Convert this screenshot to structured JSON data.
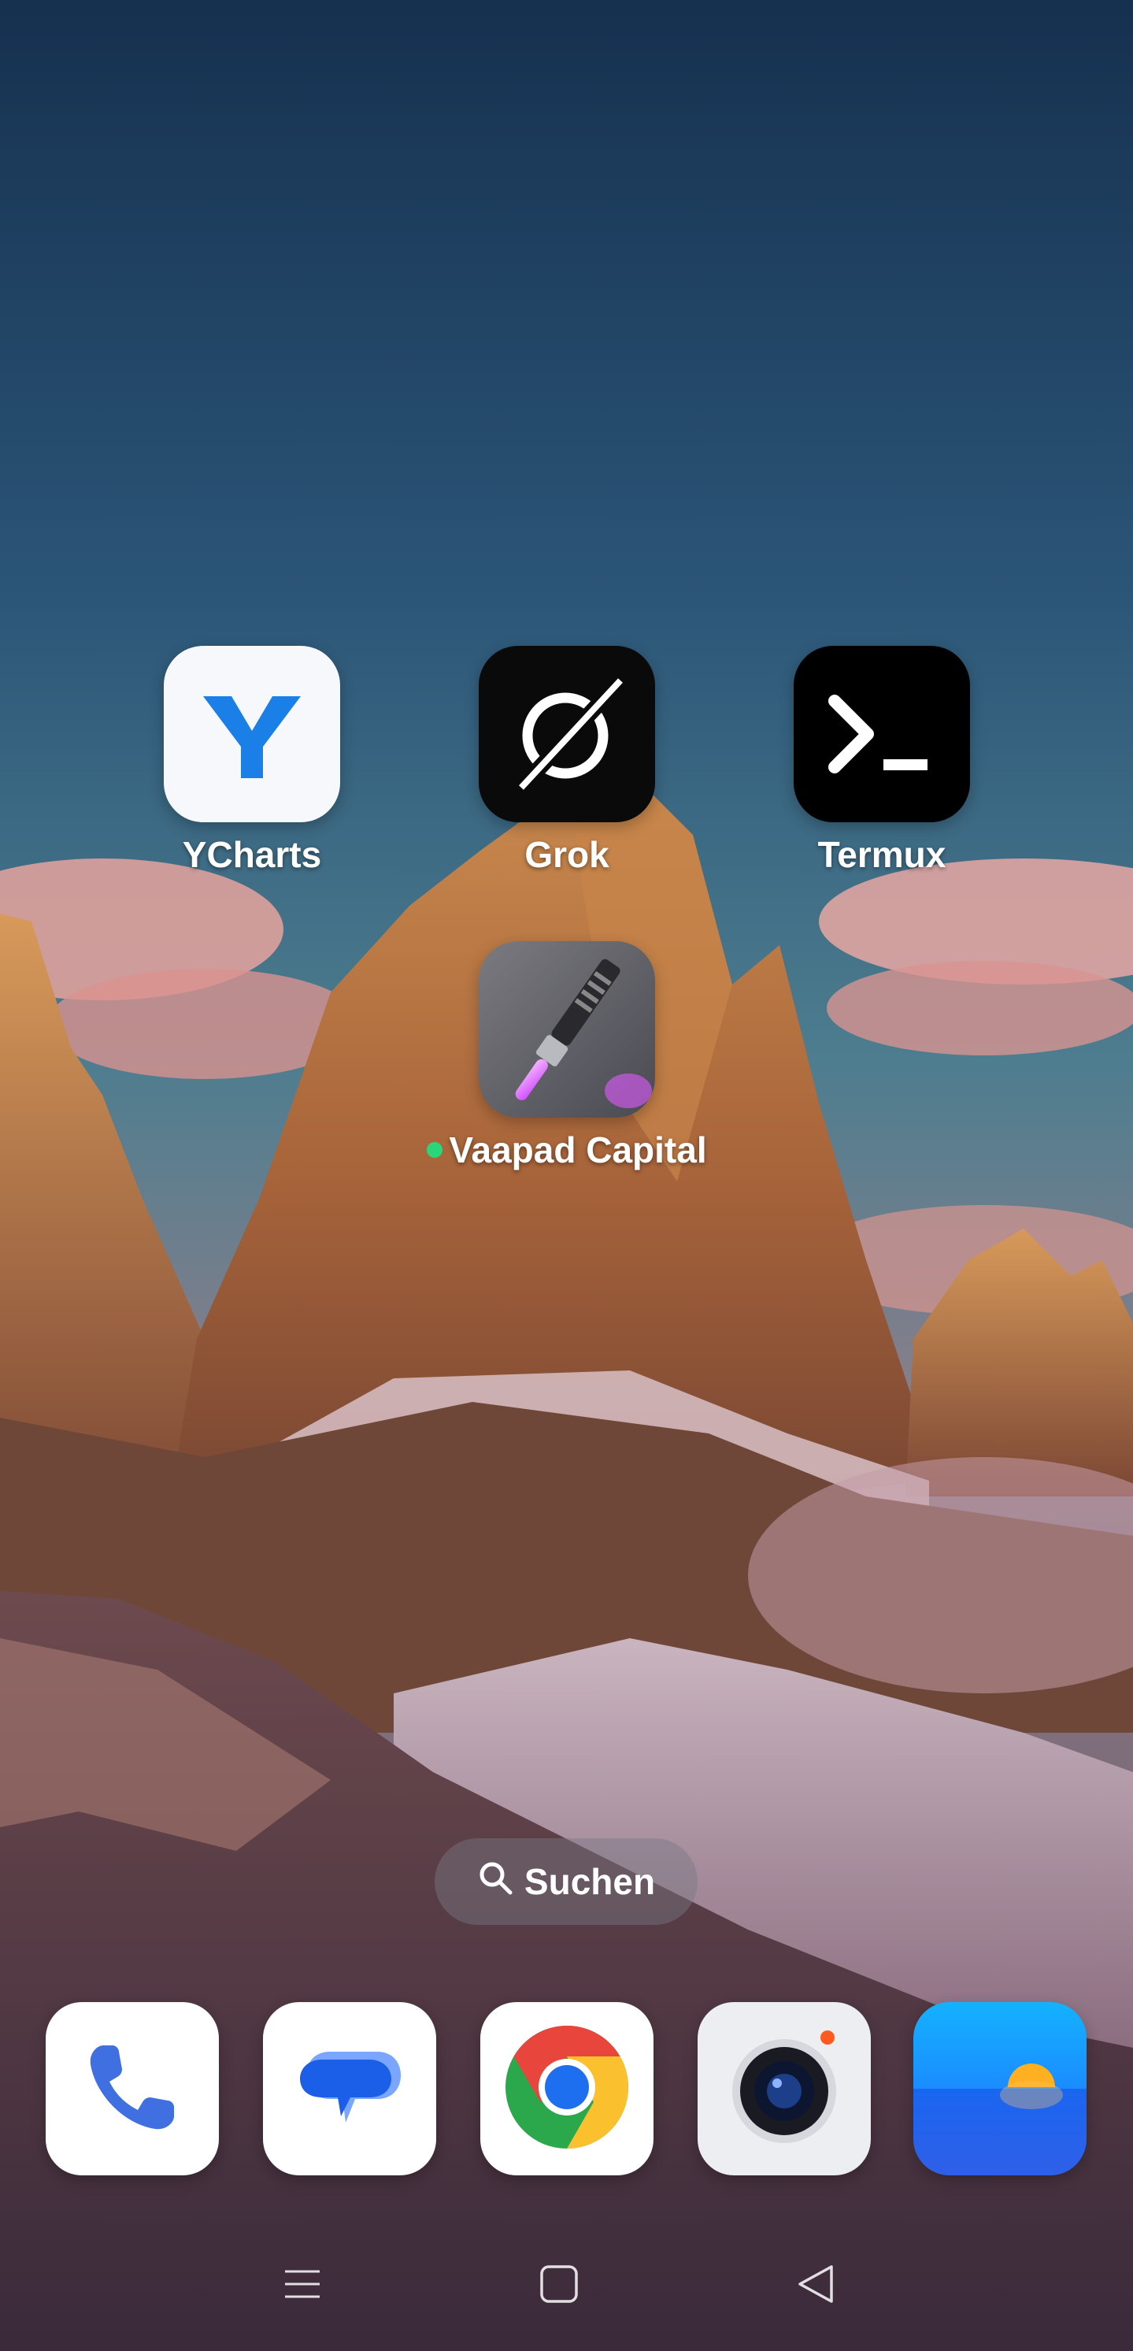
{
  "home_apps": [
    {
      "label": "YCharts",
      "icon": "ycharts-icon"
    },
    {
      "label": "Grok",
      "icon": "grok-icon"
    },
    {
      "label": "Termux",
      "icon": "terminal-icon"
    },
    {
      "label": "Vaapad Capital",
      "icon": "lightsaber-icon",
      "new_dot": true
    }
  ],
  "search": {
    "label": "Suchen",
    "icon": "search-icon"
  },
  "dock": [
    {
      "icon": "phone-icon"
    },
    {
      "icon": "messages-icon"
    },
    {
      "icon": "chrome-icon"
    },
    {
      "icon": "camera-icon"
    },
    {
      "icon": "gallery-icon"
    }
  ],
  "navbar": [
    {
      "icon": "menu-icon"
    },
    {
      "icon": "home-square-icon"
    },
    {
      "icon": "back-triangle-icon"
    }
  ],
  "colors": {
    "sky_top": "#1a3658",
    "sky_mid": "#3b6c86",
    "mountain": "#b8733f",
    "cloud": "#e8a6a0",
    "new_dot": "#2ad67a",
    "ycharts_blue": "#1a7fe6"
  }
}
